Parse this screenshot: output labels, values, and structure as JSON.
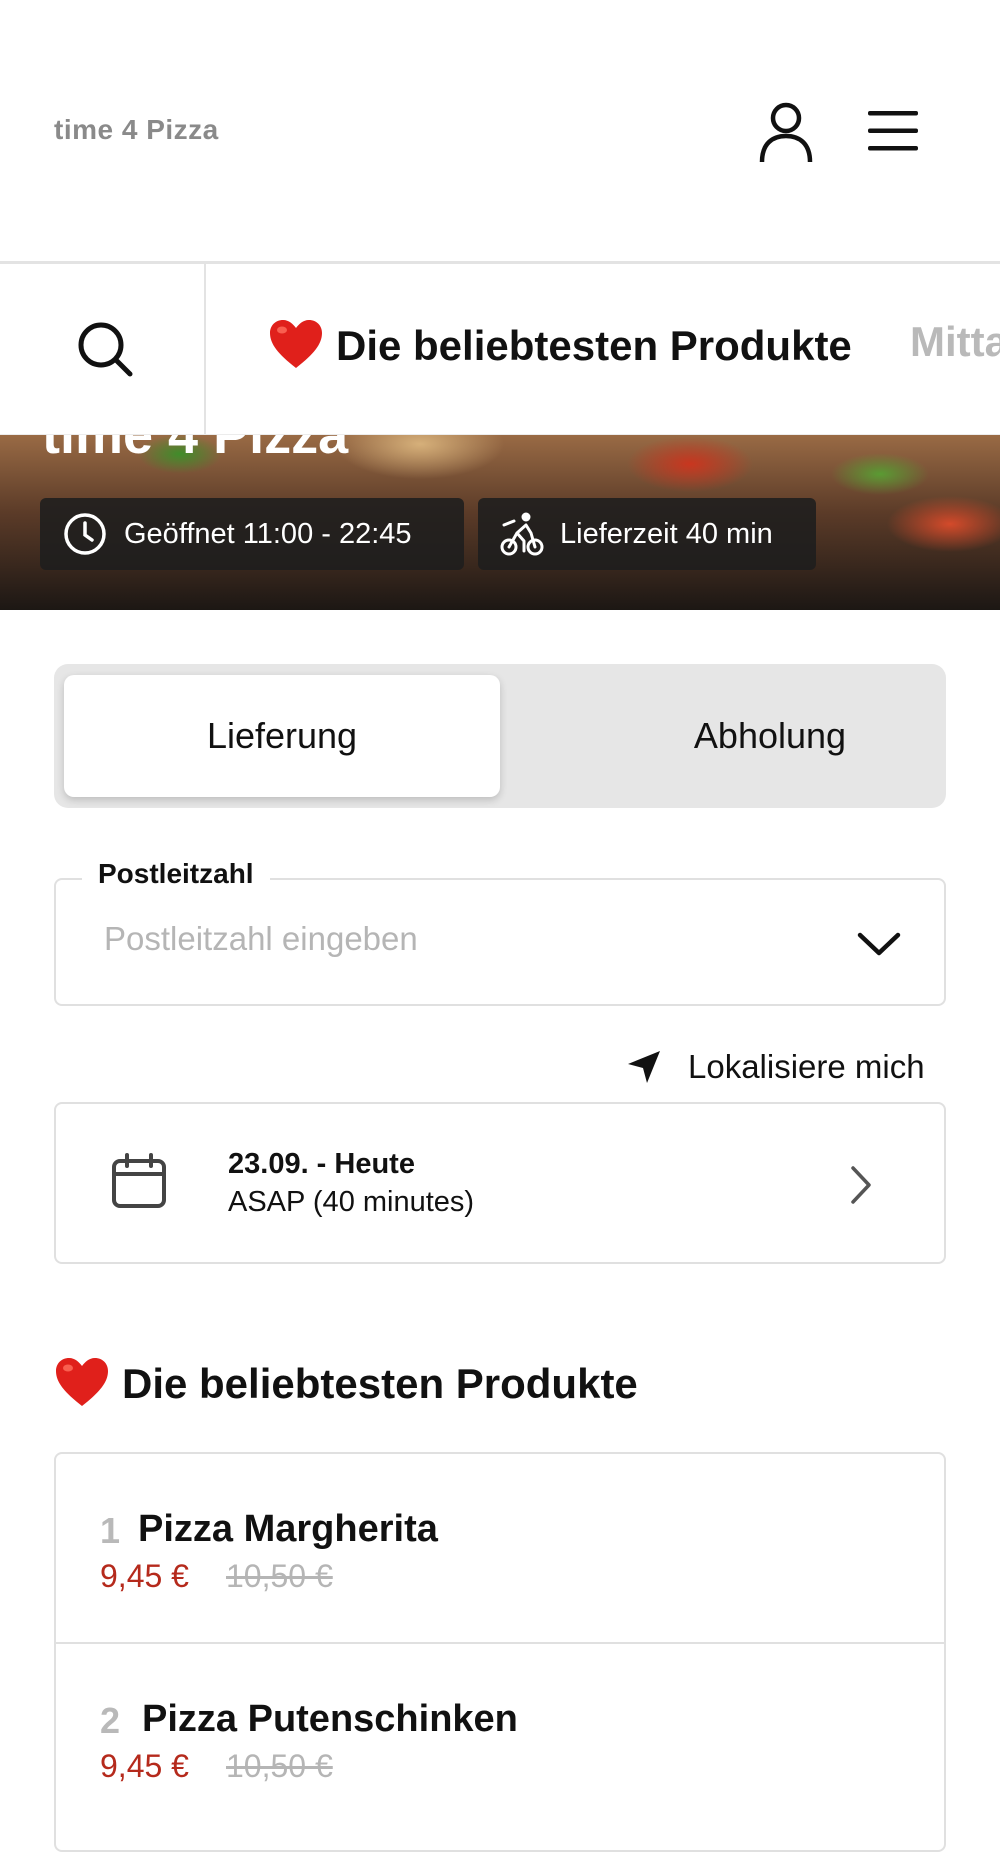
{
  "header": {
    "brand": "time 4 Pizza",
    "user_icon": "user-icon",
    "menu_icon": "hamburger-menu-icon"
  },
  "category_nav": {
    "search_icon": "search-icon",
    "active_label": "Die beliebtesten Produkte",
    "next_label": "Mitta"
  },
  "hero": {
    "title": "time 4 Pizza",
    "opening": "Geöffnet 11:00 - 22:45",
    "delivery_time": "Lieferzeit 40 min"
  },
  "order_type": {
    "options": [
      "Lieferung",
      "Abholung"
    ],
    "selected": "Lieferung"
  },
  "postcode": {
    "label": "Postleitzahl",
    "value": "",
    "placeholder": "Postleitzahl eingeben"
  },
  "locate_label": "Lokalisiere mich",
  "schedule": {
    "date": "23.09. - Heute",
    "time": "ASAP (40 minutes)"
  },
  "popular": {
    "title": "Die beliebtesten Produkte",
    "items": [
      {
        "rank": "1",
        "name": "Pizza Margherita",
        "price": "9,45 €",
        "old_price": "10,50 €"
      },
      {
        "rank": "2",
        "name": "Pizza Putenschinken",
        "price": "9,45 €",
        "old_price": "10,50 €"
      }
    ]
  },
  "colors": {
    "price_red": "#b52a1c",
    "heart_red": "#e0201b",
    "toggle_bg": "#e6e6e6"
  }
}
